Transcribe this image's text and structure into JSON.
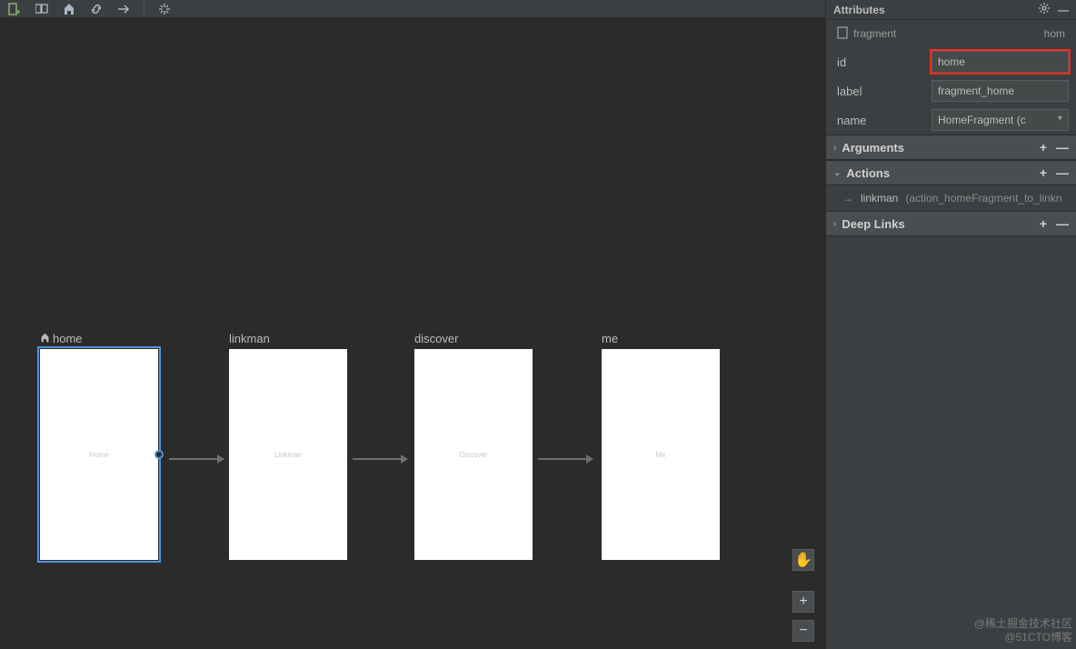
{
  "toolbar": {
    "info_icon": "info-icon",
    "help_icon": "help-icon"
  },
  "canvas": {
    "destinations": [
      {
        "label": "home",
        "inner": "Home",
        "is_start": true,
        "selected": true
      },
      {
        "label": "linkman",
        "inner": "Linkman",
        "is_start": false,
        "selected": false
      },
      {
        "label": "discover",
        "inner": "Discover",
        "is_start": false,
        "selected": false
      },
      {
        "label": "me",
        "inner": "Me",
        "is_start": false,
        "selected": false
      }
    ]
  },
  "zoom": {
    "pan": "✋",
    "plus": "+",
    "minus": "−"
  },
  "attributes": {
    "title": "Attributes",
    "type_label": "fragment",
    "type_value": "hom",
    "fields": {
      "id": {
        "label": "id",
        "value": "home"
      },
      "label": {
        "label": "label",
        "value": "fragment_home"
      },
      "name": {
        "label": "name",
        "value": "HomeFragment (c"
      }
    },
    "sections": {
      "arguments": "Arguments",
      "actions": "Actions",
      "deeplinks": "Deep Links"
    },
    "action_item": {
      "name": "linkman",
      "detail": "(action_homeFragment_to_linkn"
    }
  },
  "watermark": {
    "line1": "@稀土掘金技术社区",
    "line2": "@51CTO博客"
  }
}
